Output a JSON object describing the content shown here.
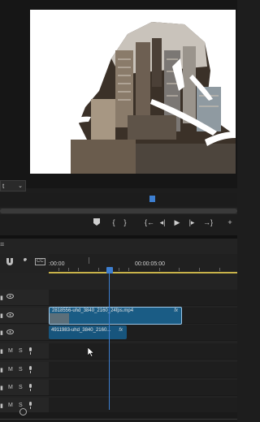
{
  "program_monitor": {
    "zoom_level": "t",
    "zoom_chevron": "⌄",
    "transport": {
      "marker_icon": "marker-icon",
      "in_point": "{",
      "out_point": "}",
      "go_to_in": "{←",
      "step_back": "◂|",
      "play": "▶",
      "step_forward": "|▸",
      "go_to_out": "→}",
      "add": "+"
    }
  },
  "timeline": {
    "menu": "≡",
    "tools": {
      "snap_icon": "magnet-icon",
      "linked_icon": "wrench-icon",
      "captions_label": "CC"
    },
    "ruler": {
      "start_timecode": ":00:00",
      "mid_timecode": "00:00:05:00"
    },
    "tracks": [
      {
        "id": "v3",
        "type": "video"
      },
      {
        "id": "v2",
        "type": "video"
      },
      {
        "id": "v1",
        "type": "video"
      },
      {
        "id": "a1",
        "type": "audio",
        "m": "M",
        "s": "S"
      },
      {
        "id": "a2",
        "type": "audio",
        "m": "M",
        "s": "S"
      },
      {
        "id": "a3",
        "type": "audio",
        "m": "M",
        "s": "S"
      },
      {
        "id": "a4",
        "type": "audio",
        "m": "M",
        "s": "S"
      }
    ],
    "clips": {
      "v2": {
        "name": "2818556-uhd_3840_2160_24fps.mp4",
        "fx": "fx"
      },
      "v1": {
        "name": "4911983-uhd_3840_2160...",
        "fx": "fx"
      }
    }
  },
  "colors": {
    "accent": "#3d7fd1",
    "clip": "#1a5c85",
    "work_area": "#c9b34a"
  }
}
